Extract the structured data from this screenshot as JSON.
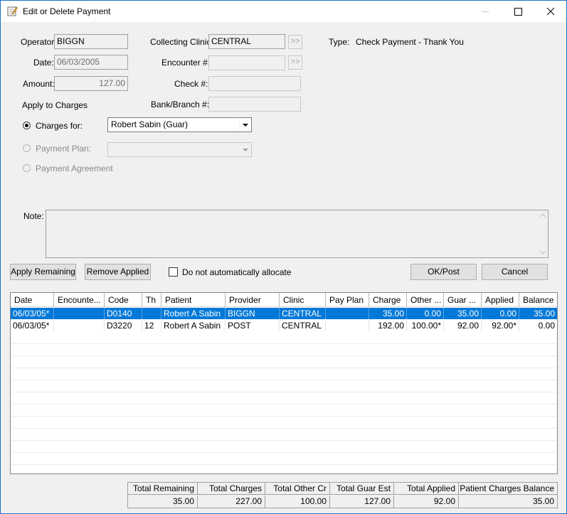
{
  "window": {
    "title": "Edit or Delete Payment"
  },
  "form": {
    "operator_label": "Operator:",
    "operator_value": "BIGGN",
    "date_label": "Date:",
    "date_value": "06/03/2005",
    "amount_label": "Amount:",
    "amount_value": "127.00",
    "collecting_clinic_label": "Collecting Clinic:",
    "collecting_clinic_value": "CENTRAL",
    "encounter_label": "Encounter #:",
    "encounter_value": "",
    "check_label": "Check #:",
    "check_value": "",
    "bank_label": "Bank/Branch #:",
    "bank_value": "",
    "type_label": "Type:",
    "type_value": "Check Payment - Thank You",
    "lookup_button": ">>"
  },
  "apply": {
    "section_label": "Apply to Charges",
    "charges_for_label": "Charges for:",
    "charges_for_value": "Robert Sabin (Guar)",
    "payment_plan_label": "Payment Plan:",
    "payment_plan_value": "",
    "payment_agreement_label": "Payment Agreement",
    "selected_option": "charges_for"
  },
  "note": {
    "label": "Note:",
    "value": ""
  },
  "buttons": {
    "apply_remaining": "Apply Remaining",
    "remove_applied": "Remove Applied",
    "no_auto_allocate": "Do not automatically allocate",
    "ok_post": "OK/Post",
    "cancel": "Cancel"
  },
  "grid": {
    "columns": [
      "Date",
      "Encounte...",
      "Code",
      "Th",
      "Patient",
      "Provider",
      "Clinic",
      "Pay Plan",
      "Charge",
      "Other ...",
      "Guar ...",
      "Applied",
      "Balance"
    ],
    "rows": [
      {
        "date": "06/03/05*",
        "encounter": "",
        "code": "D0140",
        "th": "",
        "patient": "Robert A Sabin",
        "provider": "BIGGN",
        "clinic": "CENTRAL",
        "pay_plan": "",
        "charge": "35.00",
        "other": "0.00",
        "guar": "35.00",
        "applied": "0.00",
        "balance": "35.00"
      },
      {
        "date": "06/03/05*",
        "encounter": "",
        "code": "D3220",
        "th": "12",
        "patient": "Robert A Sabin",
        "provider": "POST",
        "clinic": "CENTRAL",
        "pay_plan": "",
        "charge": "192.00",
        "other": "100.00*",
        "guar": "92.00",
        "applied": "92.00*",
        "balance": "0.00"
      }
    ]
  },
  "totals": {
    "headers": [
      "Total Remaining",
      "Total Charges",
      "Total Other Cr",
      "Total Guar Est",
      "Total Applied",
      "Patient Charges Balance"
    ],
    "values": [
      "35.00",
      "227.00",
      "100.00",
      "127.00",
      "92.00",
      "35.00"
    ]
  },
  "colors": {
    "selection": "#0078d7",
    "window_border": "#1c6fc7",
    "dialog_bg": "#f0f0f0"
  }
}
